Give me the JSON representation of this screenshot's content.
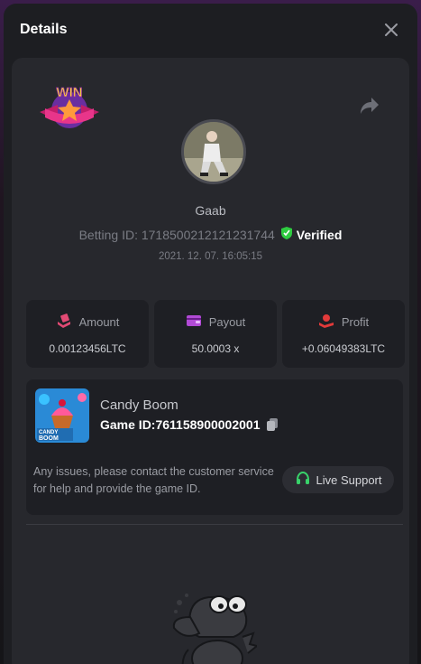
{
  "header": {
    "title": "Details"
  },
  "user": {
    "name": "Gaab"
  },
  "bet": {
    "betting_id": "Betting ID: 1718500212121231744",
    "verified_label": "Verified",
    "timestamp": "2021. 12. 07. 16:05:15"
  },
  "stats": [
    {
      "label": "Amount",
      "value": "0.00123456LTC",
      "icon": "money-hand-icon",
      "color": "#e24a74"
    },
    {
      "label": "Payout",
      "value": "50.0003 x",
      "icon": "wallet-icon",
      "color": "#b24ad6"
    },
    {
      "label": "Profit",
      "value": "+0.06049383LTC",
      "icon": "coins-hand-icon",
      "color": "#e23a3a"
    }
  ],
  "game": {
    "name": "Candy Boom",
    "game_id": "Game ID:761158900002001",
    "thumb_text_1": "CANDY",
    "thumb_text_2": "BOOM"
  },
  "support": {
    "help_text": "Any issues, please contact the customer service for help and provide the game ID.",
    "button_label": "Live Support"
  },
  "badge": {
    "text": "WIN"
  },
  "colors": {
    "verified": "#2ecc40",
    "support_icon": "#38d26a",
    "accent": "#e24a74"
  }
}
